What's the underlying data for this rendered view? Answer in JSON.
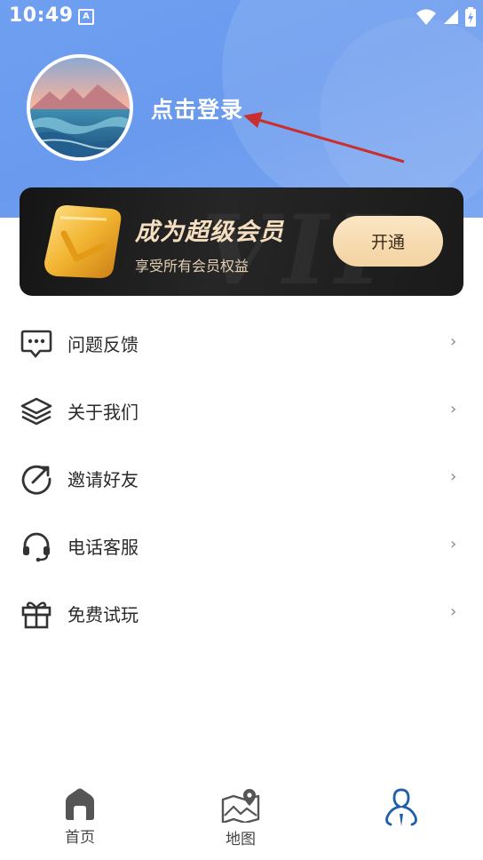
{
  "status_bar": {
    "time": "10:49",
    "notification_glyph": "A"
  },
  "profile": {
    "login_text": "点击登录"
  },
  "vip": {
    "title": "成为超级会员",
    "subtitle": "享受所有会员权益",
    "watermark": "VIP",
    "button_label": "开通"
  },
  "menu": [
    {
      "label": "问题反馈",
      "icon": "feedback-icon"
    },
    {
      "label": "关于我们",
      "icon": "layers-icon"
    },
    {
      "label": "邀请好友",
      "icon": "share-icon"
    },
    {
      "label": "电话客服",
      "icon": "headset-icon"
    },
    {
      "label": "免费试玩",
      "icon": "gift-icon"
    }
  ],
  "menu_chevron": "›",
  "tabbar": [
    {
      "label": "首页",
      "icon": "home-icon"
    },
    {
      "label": "地图",
      "icon": "map-icon"
    },
    {
      "label": "",
      "icon": "profile-icon",
      "active": true
    }
  ],
  "colors": {
    "header": "#6f9ff0",
    "vip_gold": "#f5dfc0",
    "active_tab": "#1f5fa8"
  }
}
